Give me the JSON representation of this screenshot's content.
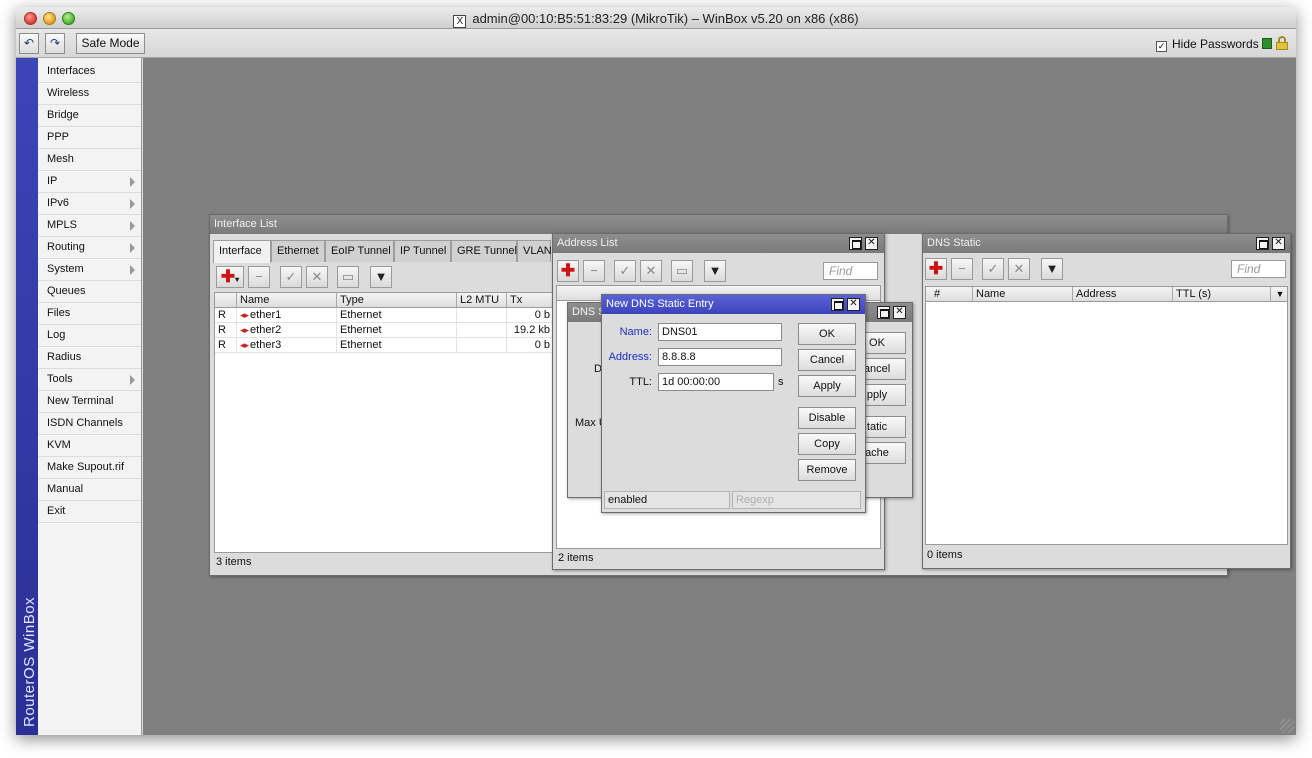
{
  "window": {
    "title": "admin@00:10:B5:51:83:29 (MikroTik) – WinBox v5.20 on x86 (x86)",
    "x_icon": "X"
  },
  "toolbar": {
    "undo_icon": "↶",
    "redo_icon": "↷",
    "safe_mode_label": "Safe Mode",
    "hide_passwords_label": "Hide Passwords",
    "hide_passwords_checked": "✓"
  },
  "sidebar": {
    "brand": "RouterOS WinBox",
    "items": [
      {
        "label": "Interfaces",
        "submenu": false
      },
      {
        "label": "Wireless",
        "submenu": false
      },
      {
        "label": "Bridge",
        "submenu": false
      },
      {
        "label": "PPP",
        "submenu": false
      },
      {
        "label": "Mesh",
        "submenu": false
      },
      {
        "label": "IP",
        "submenu": true
      },
      {
        "label": "IPv6",
        "submenu": true
      },
      {
        "label": "MPLS",
        "submenu": true
      },
      {
        "label": "Routing",
        "submenu": true
      },
      {
        "label": "System",
        "submenu": true
      },
      {
        "label": "Queues",
        "submenu": false
      },
      {
        "label": "Files",
        "submenu": false
      },
      {
        "label": "Log",
        "submenu": false
      },
      {
        "label": "Radius",
        "submenu": false
      },
      {
        "label": "Tools",
        "submenu": true
      },
      {
        "label": "New Terminal",
        "submenu": false
      },
      {
        "label": "ISDN Channels",
        "submenu": false
      },
      {
        "label": "KVM",
        "submenu": false
      },
      {
        "label": "Make Supout.rif",
        "submenu": false
      },
      {
        "label": "Manual",
        "submenu": false
      },
      {
        "label": "Exit",
        "submenu": false
      }
    ]
  },
  "interface_list": {
    "title": "Interface List",
    "tabs": [
      "Interface",
      "Ethernet",
      "EoIP Tunnel",
      "IP Tunnel",
      "GRE Tunnel",
      "VLAN"
    ],
    "columns": [
      "Name",
      "Type",
      "L2 MTU",
      "Tx"
    ],
    "rows": [
      {
        "flag": "R",
        "name": "ether1",
        "type": "Ethernet",
        "l2mtu": "",
        "tx": "0 b"
      },
      {
        "flag": "R",
        "name": "ether2",
        "type": "Ethernet",
        "l2mtu": "",
        "tx": "19.2 kb"
      },
      {
        "flag": "R",
        "name": "ether3",
        "type": "Ethernet",
        "l2mtu": "",
        "tx": "0 b"
      }
    ],
    "status": "3 items"
  },
  "address_list": {
    "title": "Address List",
    "find_placeholder": "Find",
    "status": "2 items"
  },
  "dns_settings": {
    "title_fragment": "DNS S",
    "label_d": "D",
    "label_max": "Max U",
    "buttons": [
      "OK",
      "ancel",
      "pply",
      "tatic",
      "ache"
    ]
  },
  "new_dns_entry": {
    "title": "New DNS Static Entry",
    "name_label": "Name:",
    "name_value": "DNS01",
    "address_label": "Address:",
    "address_value": "8.8.8.8",
    "ttl_label": "TTL:",
    "ttl_value": "1d 00:00:00",
    "ttl_unit": "s",
    "buttons": [
      "OK",
      "Cancel",
      "Apply",
      "Disable",
      "Copy",
      "Remove"
    ],
    "status_left": "enabled",
    "status_right": "Regexp"
  },
  "dns_static": {
    "title": "DNS Static",
    "find_placeholder": "Find",
    "columns": [
      "#",
      "Name",
      "Address",
      "TTL (s)"
    ],
    "status": "0 items"
  }
}
